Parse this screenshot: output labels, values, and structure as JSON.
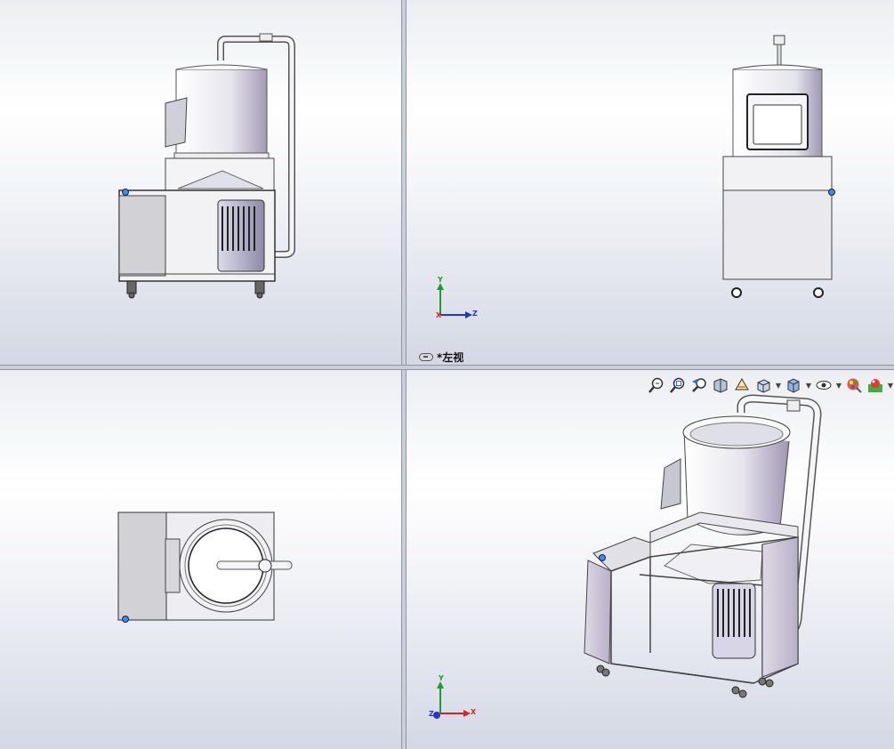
{
  "viewports": {
    "top_right": {
      "view_label": "*左视"
    }
  },
  "triad": {
    "x": "X",
    "y": "Y",
    "z": "Z"
  },
  "toolbar": {
    "icons": [
      "zoom-to-fit-icon",
      "zoom-to-area-icon",
      "previous-view-icon",
      "section-view-icon",
      "dynamic-annotation-icon",
      "view-orientation-icon",
      "display-style-icon",
      "hide-show-items-icon",
      "edit-appearance-icon",
      "apply-scene-icon"
    ]
  },
  "colors": {
    "viewport_top": "#eceef3",
    "viewport_bottom": "#d3d8e4",
    "x_axis": "#e0201c",
    "y_axis": "#1d9c2f",
    "z_axis": "#2633c8",
    "selection_point": "#3a8ee6"
  }
}
